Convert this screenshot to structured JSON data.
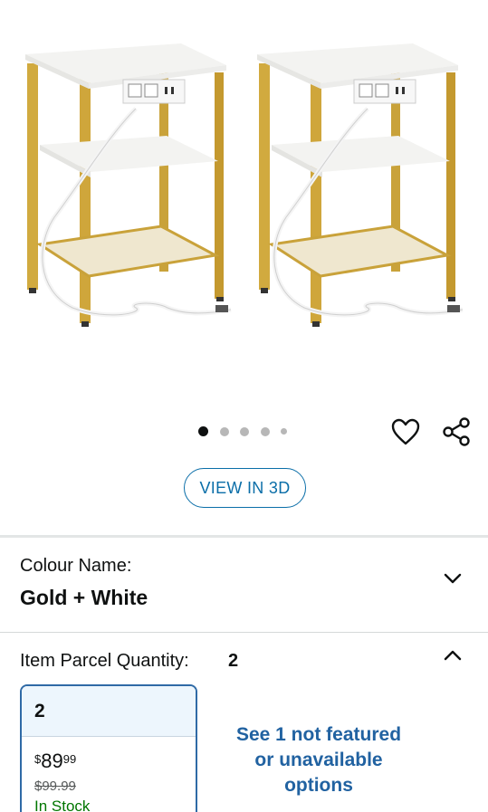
{
  "gallery": {
    "image_alt": "Two white and gold bedside tables with charging station",
    "dots_count": 5,
    "active_dot": 0
  },
  "actions": {
    "wishlist_icon": "heart-icon",
    "share_icon": "share-icon"
  },
  "view_3d": {
    "label": "VIEW IN 3D"
  },
  "colour": {
    "label": "Colour Name:",
    "value": "Gold + White"
  },
  "quantity": {
    "label": "Item Parcel Quantity:",
    "value": "2",
    "option": {
      "title": "2",
      "currency": "$",
      "price_whole": "89",
      "price_fraction": "99",
      "was_price": "$99.99",
      "stock": "In Stock"
    },
    "not_featured": "See 1 not featured or unavailable options"
  },
  "colors": {
    "accent": "#0a6ea8",
    "selected_border": "#2f6aa6",
    "link": "#2162a1",
    "stock": "#007600"
  }
}
